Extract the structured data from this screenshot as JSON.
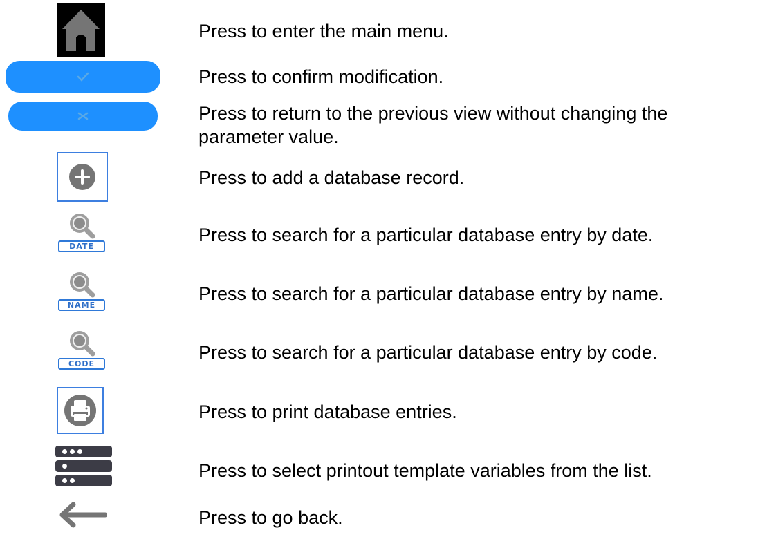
{
  "colors": {
    "accent_blue": "#1e90ff",
    "frame_blue": "#3d7fe0",
    "icon_gray": "#757575",
    "dark": "#3c3c46"
  },
  "rows": [
    {
      "icon": "home-icon",
      "text": "Press to enter the main menu."
    },
    {
      "icon": "confirm-check-icon",
      "text": "Press to confirm modification."
    },
    {
      "icon": "cancel-x-icon",
      "text": "Press to return to the previous view without changing the parameter value."
    },
    {
      "icon": "add-record-icon",
      "text": "Press to add a database record."
    },
    {
      "icon": "search-date-icon",
      "tag": "DATE",
      "text": "Press to search for a particular database entry by date."
    },
    {
      "icon": "search-name-icon",
      "tag": "NAME",
      "text": "Press to search for a particular database entry by name."
    },
    {
      "icon": "search-code-icon",
      "tag": "CODE",
      "text": "Press to search for a particular database entry by code."
    },
    {
      "icon": "printer-icon",
      "text": "Press to print database entries."
    },
    {
      "icon": "variables-list-icon",
      "text": "Press to select printout template variables from the list."
    },
    {
      "icon": "back-arrow-icon",
      "text": "Press to go back."
    }
  ]
}
